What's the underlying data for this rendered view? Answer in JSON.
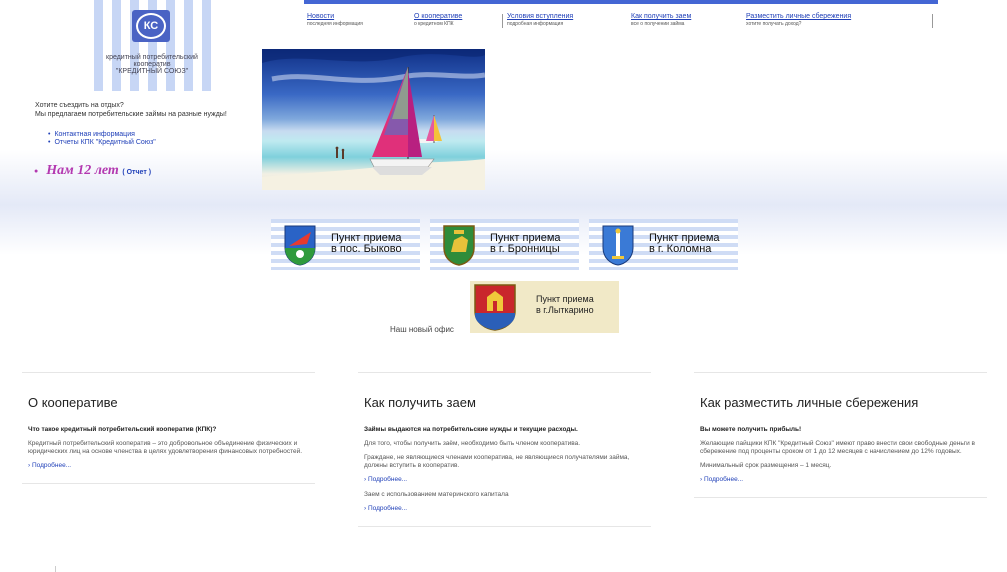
{
  "logo": {
    "badge": "КС",
    "line1": "кредитный потребительский",
    "line2": "кооператив",
    "line3": "\"КРЕДИТНЫЙ СОЮЗ\""
  },
  "intro": {
    "line1": "Хотите съездить на отдых?",
    "line2": "Мы предлагаем потребительские займы на разные нужды!"
  },
  "side_links": [
    {
      "label": "Контактная информация"
    },
    {
      "label": "Отчеты КПК \"Кредитный Союз\""
    }
  ],
  "anniversary": {
    "text": "Нам 12 лет",
    "report_label": "( Отчет )"
  },
  "top_nav": [
    {
      "title": "Новости",
      "subtitle": "последняя информация"
    },
    {
      "title": "О кооперативе",
      "subtitle": "о кредитном КПК"
    },
    {
      "title": "Условия вступления",
      "subtitle": "подробная информация"
    },
    {
      "title": "Как получить заем",
      "subtitle": "все о получении займа"
    },
    {
      "title": "Разместить личные сбережения",
      "subtitle": "хотите получать доход?"
    }
  ],
  "points": [
    {
      "line1": "Пункт приема",
      "line2": "в пос. Быково"
    },
    {
      "line1": "Пункт приема",
      "line2": "в г. Бронницы"
    },
    {
      "line1": "Пункт приема",
      "line2": "в г. Коломна"
    }
  ],
  "new_office": {
    "label": "Наш новый офис",
    "line1": "Пункт приема",
    "line2": "в г.Лыткарино"
  },
  "panels": [
    {
      "title": "О кооперативе",
      "items": [
        {
          "kind": "q",
          "text": "Что такое кредитный потребительский кооператив (КПК)?"
        },
        {
          "kind": "p",
          "text": "Кредитный потребительский кооператив – это добровольное объединение физических и юридических лиц на основе членства в целях удовлетворения финансовых потребностей."
        },
        {
          "kind": "more",
          "text": "Подробнее..."
        }
      ]
    },
    {
      "title": "Как получить заем",
      "items": [
        {
          "kind": "q",
          "text": "Займы выдаются на потребительские нужды и текущие расходы."
        },
        {
          "kind": "p",
          "text": "Для того, чтобы получить заём, необходимо быть членом кооператива."
        },
        {
          "kind": "p",
          "text": "Граждане, не являющиеся членами кооператива, не являющиеся получателями займа, должны вступить в кооператив."
        },
        {
          "kind": "more",
          "text": "Подробнее..."
        },
        {
          "kind": "p",
          "text": "Заем с использованием материнского капитала"
        },
        {
          "kind": "more",
          "text": "Подробнее..."
        }
      ]
    },
    {
      "title": "Как разместить личные сбережения",
      "items": [
        {
          "kind": "q",
          "text": "Вы можете получить прибыль!"
        },
        {
          "kind": "p",
          "text": "Желающие пайщики КПК \"Кредитный Союз\" имеют право внести свои свободные деньги в сбережение под проценты сроком от 1 до 12 месяцев с начислением до 12% годовых."
        },
        {
          "kind": "p",
          "text": "Минимальный срок размещения – 1 месяц."
        },
        {
          "kind": "more",
          "text": "Подробнее..."
        }
      ]
    }
  ]
}
